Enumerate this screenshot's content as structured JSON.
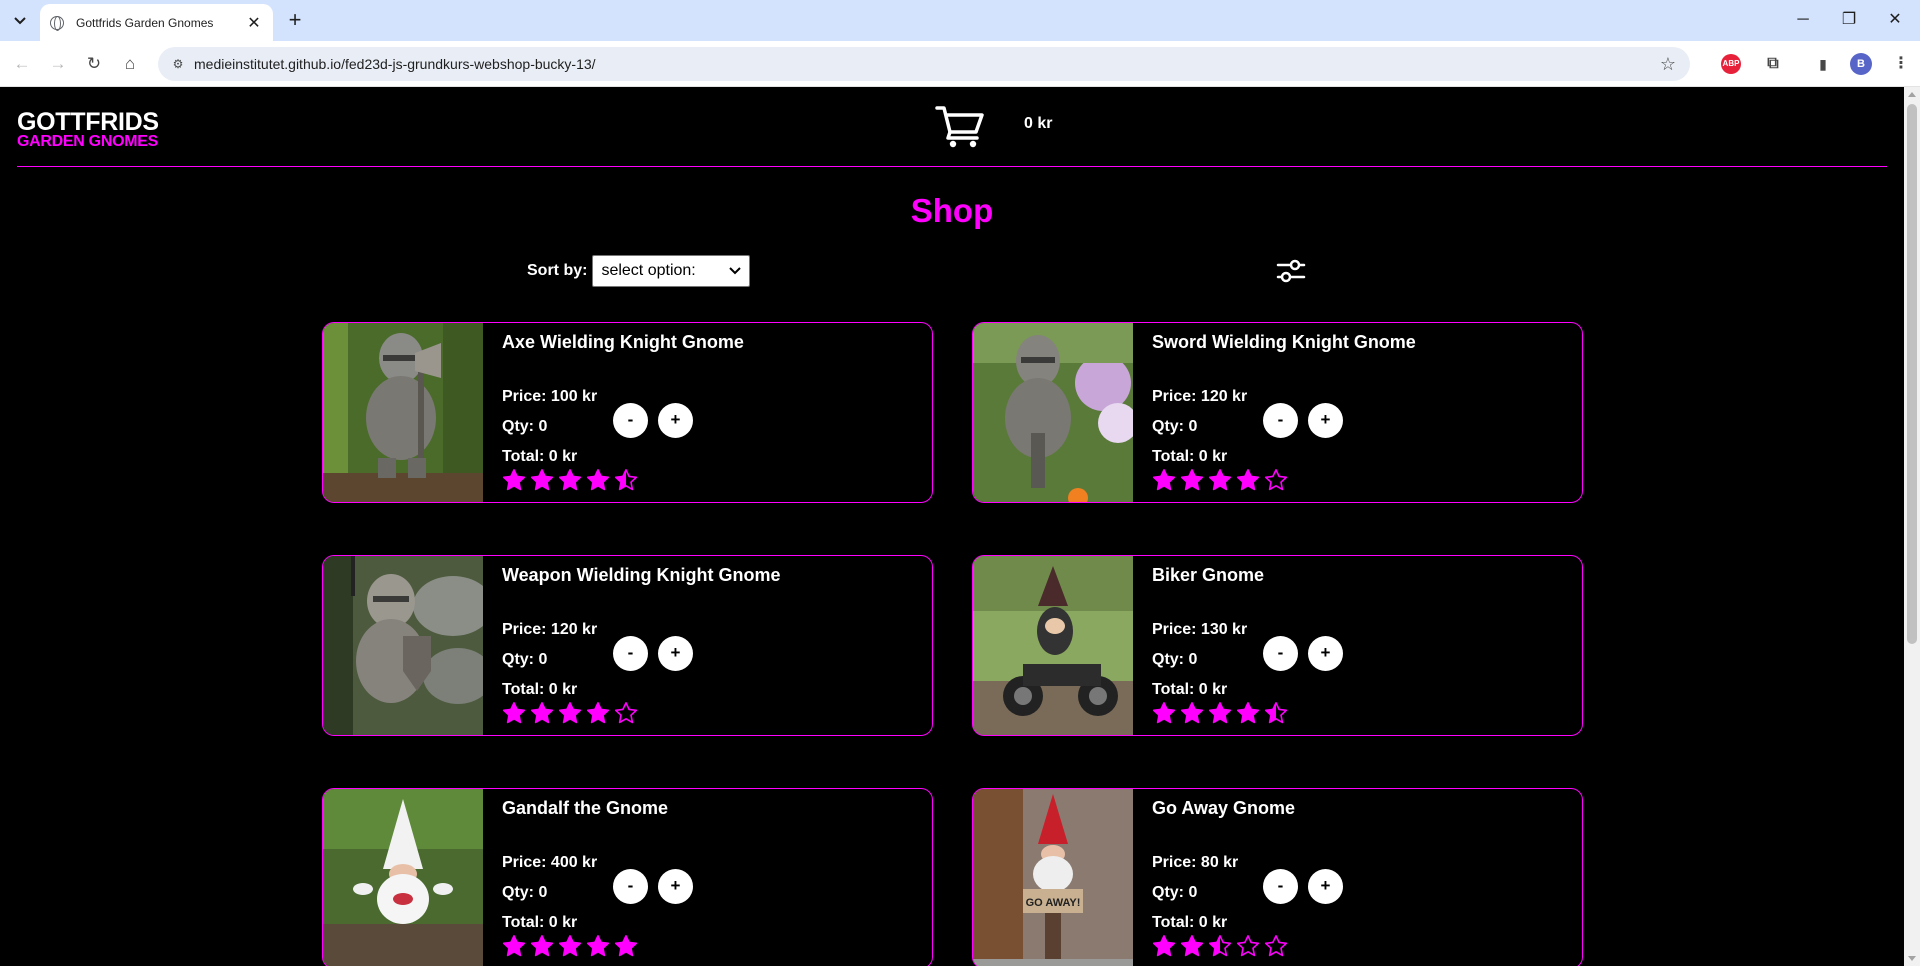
{
  "browser": {
    "tab_title": "Gottfrids Garden Gnomes",
    "url": "medieinstitutet.github.io/fed23d-js-grundkurs-webshop-bucky-13/",
    "profile_initial": "B",
    "abp_label": "ABP"
  },
  "site": {
    "logo_line1": "GOTTFRIDS",
    "logo_line2": "GARDEN GNOMES",
    "cart_total": "0 kr",
    "shop_title": "Shop",
    "sort_label": "Sort by:",
    "sort_selected": "select option:",
    "accent_color": "#ff00ff"
  },
  "products": [
    {
      "name": "Axe Wielding Knight Gnome",
      "price": "Price: 100 kr",
      "qty": "Qty: 0",
      "total": "Total: 0 kr",
      "rating": 4.5,
      "minus": "-",
      "plus": "+"
    },
    {
      "name": "Sword Wielding Knight Gnome",
      "price": "Price: 120 kr",
      "qty": "Qty: 0",
      "total": "Total: 0 kr",
      "rating": 4,
      "minus": "-",
      "plus": "+"
    },
    {
      "name": "Weapon Wielding Knight Gnome",
      "price": "Price: 120 kr",
      "qty": "Qty: 0",
      "total": "Total: 0 kr",
      "rating": 4,
      "minus": "-",
      "plus": "+"
    },
    {
      "name": "Biker Gnome",
      "price": "Price: 130 kr",
      "qty": "Qty: 0",
      "total": "Total: 0 kr",
      "rating": 4.5,
      "minus": "-",
      "plus": "+"
    },
    {
      "name": "Gandalf the Gnome",
      "price": "Price: 400 kr",
      "qty": "Qty: 0",
      "total": "Total: 0 kr",
      "rating": 5,
      "minus": "-",
      "plus": "+"
    },
    {
      "name": "Go Away Gnome",
      "price": "Price: 80 kr",
      "qty": "Qty: 0",
      "total": "Total: 0 kr",
      "rating": 2.5,
      "minus": "-",
      "plus": "+"
    }
  ],
  "product_images": [
    "knight-axe-gnome-photo",
    "knight-sword-gnome-photo",
    "knight-shield-gnome-photo",
    "biker-gnome-photo",
    "wizard-gnome-photo",
    "go-away-gnome-photo"
  ],
  "go_away_sign": "GO AWAY!"
}
